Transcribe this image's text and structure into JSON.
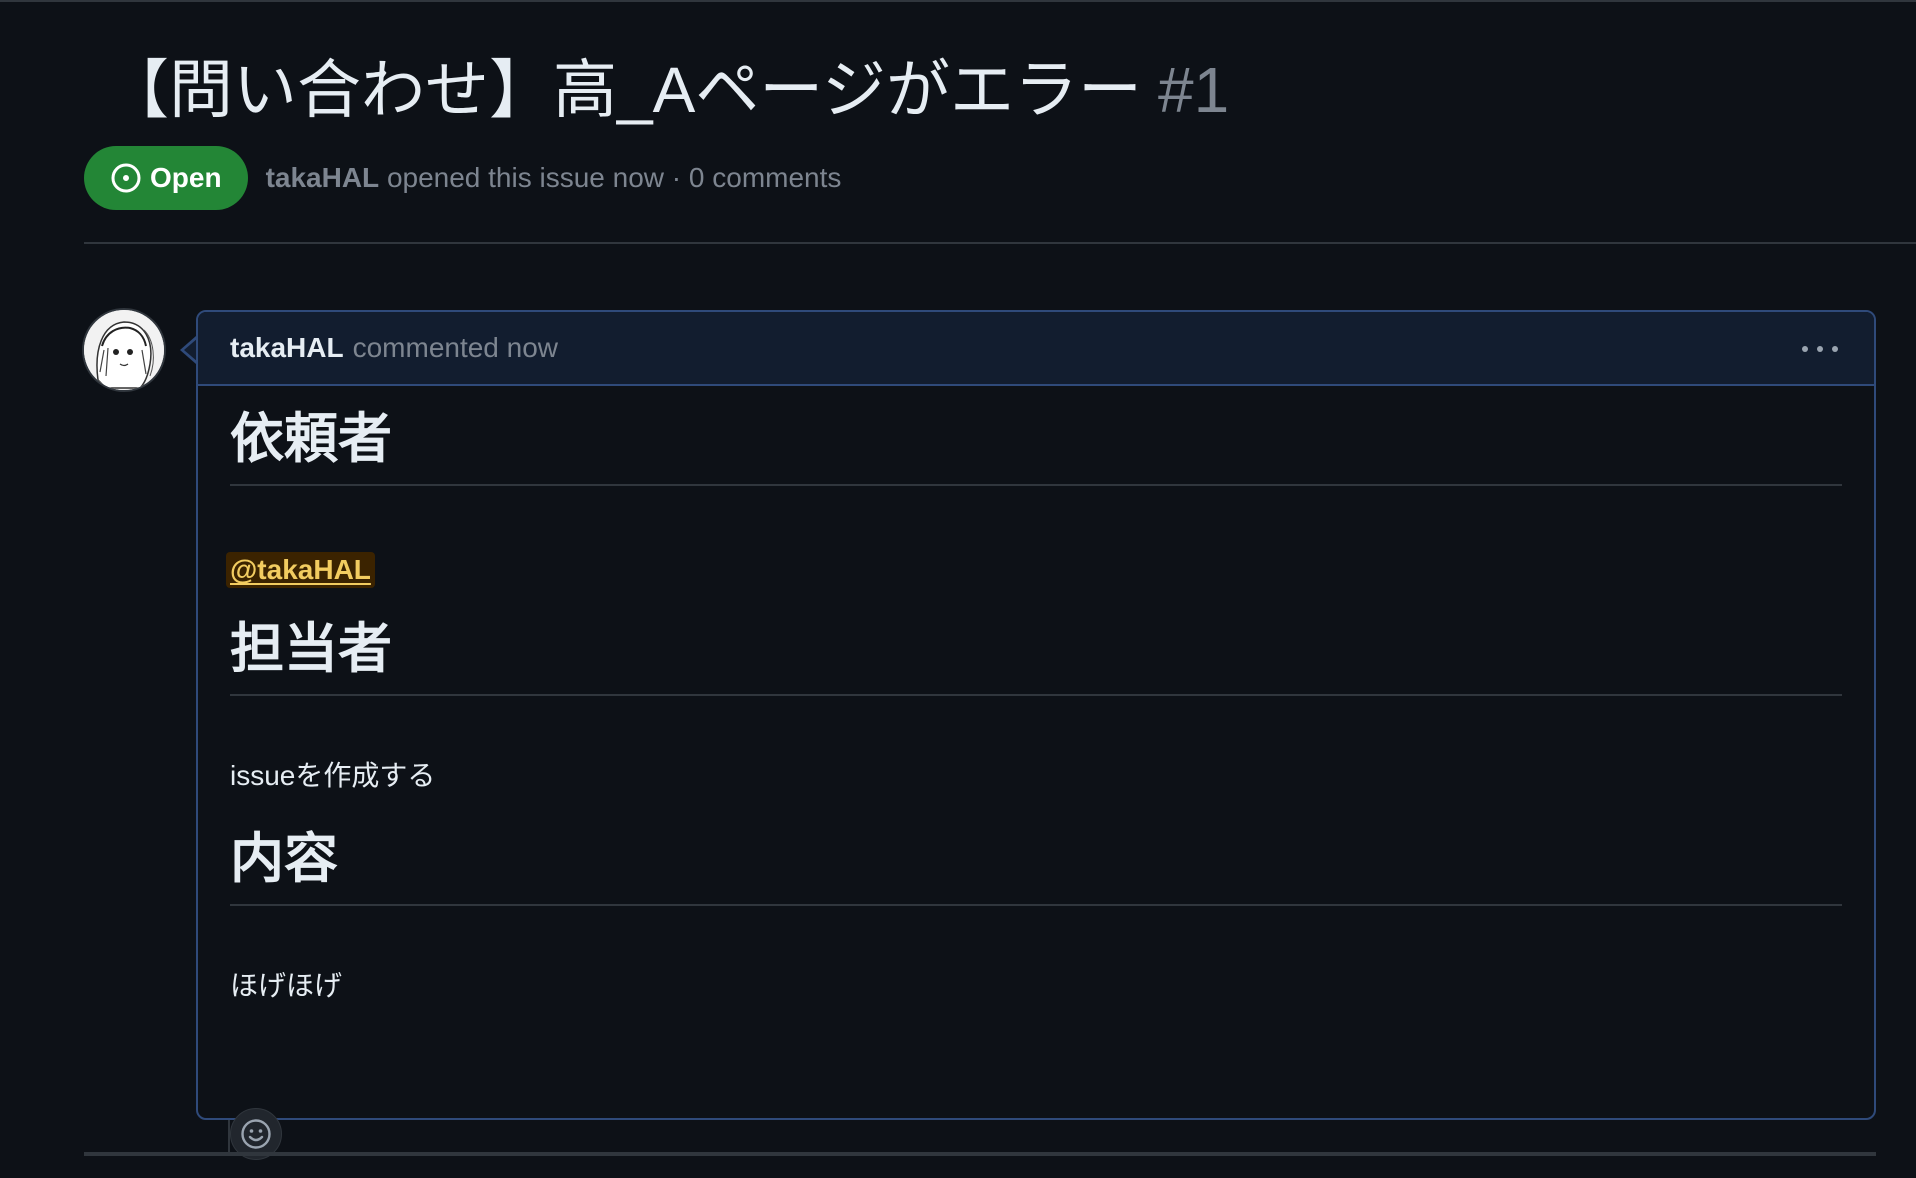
{
  "issue": {
    "title": "【問い合わせ】高_Aページがエラー",
    "number": "#1",
    "state": "Open",
    "author": "takaHAL",
    "opened_text": "opened this issue now",
    "separator": "·",
    "comments_count_text": "0 comments"
  },
  "comment": {
    "author": "takaHAL",
    "when": "commented now",
    "menu_icon": "kebab-horizontal-icon",
    "sections": {
      "requester_heading": "依頼者",
      "requester_mention": "@takaHAL",
      "assignee_heading": "担当者",
      "assignee_text": "issueを作成する",
      "content_heading": "内容",
      "content_text": "ほげほげ"
    },
    "reaction_icon": "smiley-icon"
  },
  "colors": {
    "background": "#0d1117",
    "open_badge": "#238636",
    "comment_header": "#121d2f",
    "comment_border": "#2f4a7a",
    "mention_bg": "#3b2300",
    "mention_fg": "#f2cc60",
    "muted_text": "#7d8590"
  }
}
